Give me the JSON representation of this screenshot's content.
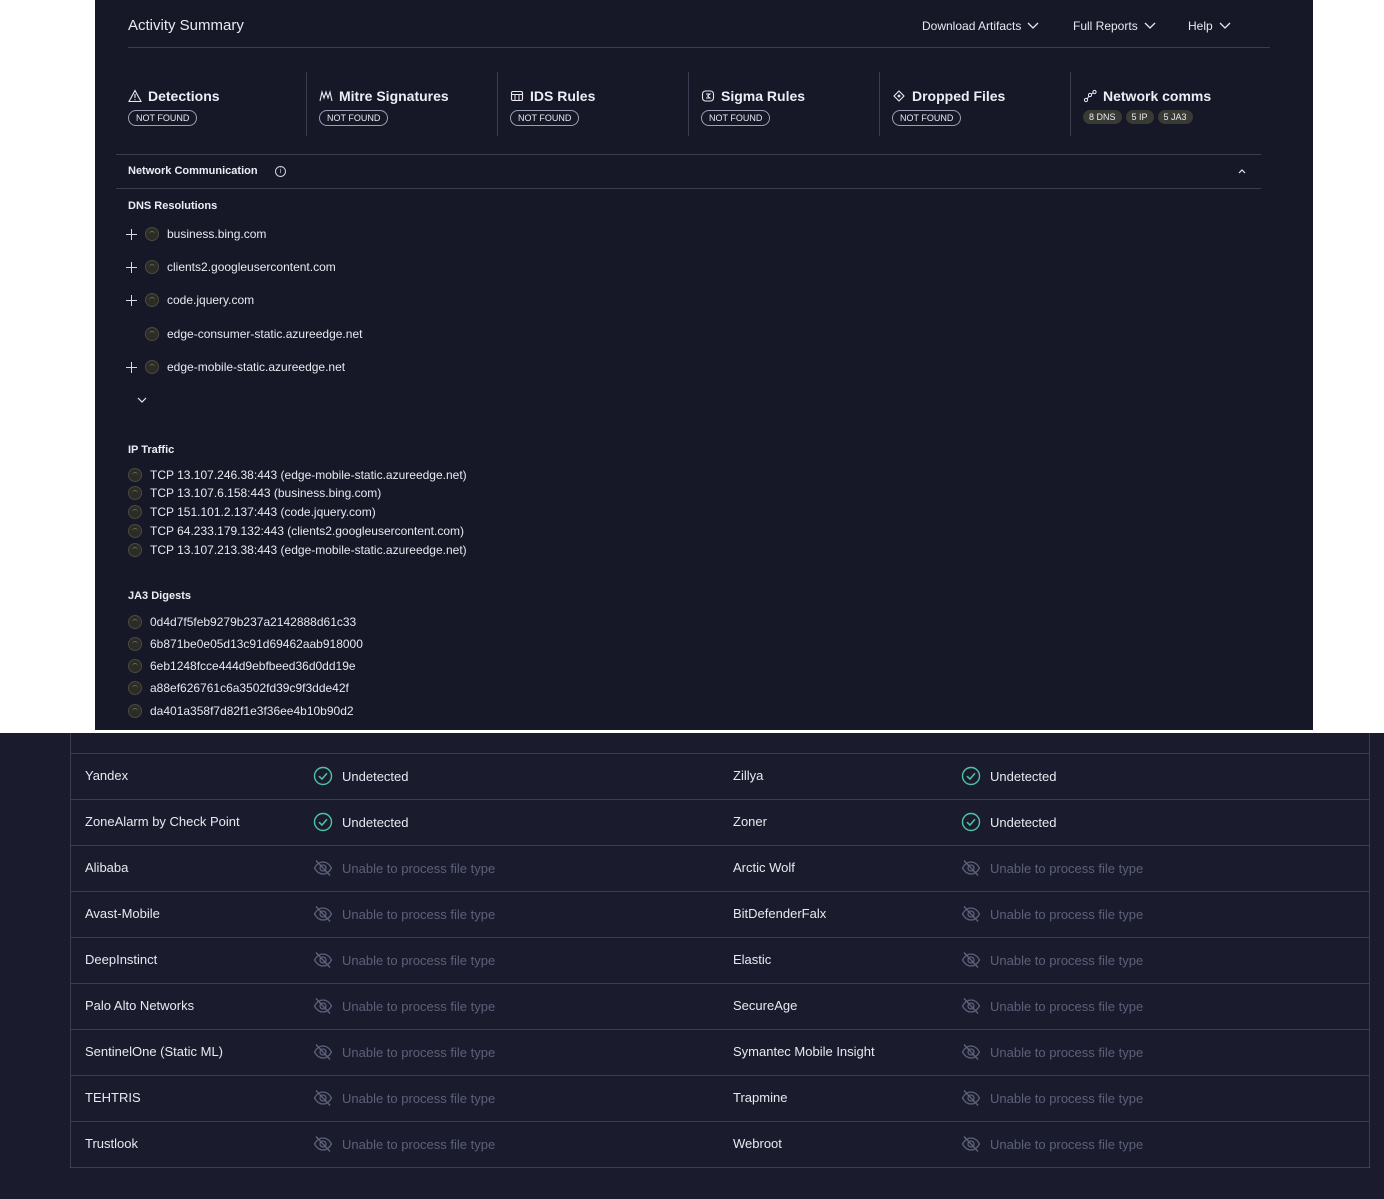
{
  "header": {
    "title": "Activity Summary",
    "menus": [
      "Download Artifacts",
      "Full Reports",
      "Help"
    ]
  },
  "cards": [
    {
      "icon": "warning-triangle-icon",
      "title": "Detections",
      "badge": "NOT FOUND"
    },
    {
      "icon": "mitre-icon",
      "title": "Mitre Signatures",
      "badge": "NOT FOUND"
    },
    {
      "icon": "ids-icon",
      "title": "IDS Rules",
      "badge": "NOT FOUND"
    },
    {
      "icon": "sigma-icon",
      "title": "Sigma Rules",
      "badge": "NOT FOUND"
    },
    {
      "icon": "dropped-files-icon",
      "title": "Dropped Files",
      "badge": "NOT FOUND"
    },
    {
      "icon": "network-icon",
      "title": "Network comms",
      "pills": [
        "8 DNS",
        "5 IP",
        "5 JA3"
      ]
    }
  ],
  "network": {
    "title": "Network Communication",
    "dns_title": "DNS Resolutions",
    "dns": [
      {
        "host": "business.bing.com",
        "expandable": true
      },
      {
        "host": "clients2.googleusercontent.com",
        "expandable": true
      },
      {
        "host": "code.jquery.com",
        "expandable": true
      },
      {
        "host": "edge-consumer-static.azureedge.net",
        "expandable": false
      },
      {
        "host": "edge-mobile-static.azureedge.net",
        "expandable": true
      }
    ],
    "ip_title": "IP Traffic",
    "ip": [
      "TCP 13.107.246.38:443 (edge-mobile-static.azureedge.net)",
      "TCP 13.107.6.158:443 (business.bing.com)",
      "TCP 151.101.2.137:443 (code.jquery.com)",
      "TCP 64.233.179.132:443 (clients2.googleusercontent.com)",
      "TCP 13.107.213.38:443 (edge-mobile-static.azureedge.net)"
    ],
    "ja3_title": "JA3 Digests",
    "ja3": [
      "0d4d7f5feb9279b237a2142888d61c33",
      "6b871be0e05d13c91d69462aab918000",
      "6eb1248fcce444d9ebfbeed36d0dd19e",
      "a88ef626761c6a3502fd39c9f3dde42f",
      "da401a358f7d82f1e3f36ee4b10b90d2"
    ]
  },
  "vendors": {
    "status_undetected": "Undetected",
    "status_unable": "Unable to process file type",
    "rows": [
      {
        "left": "Yandex",
        "left_status": "undetected",
        "right": "Zillya",
        "right_status": "undetected"
      },
      {
        "left": "ZoneAlarm by Check Point",
        "left_status": "undetected",
        "right": "Zoner",
        "right_status": "undetected"
      },
      {
        "left": "Alibaba",
        "left_status": "unable",
        "right": "Arctic Wolf",
        "right_status": "unable"
      },
      {
        "left": "Avast-Mobile",
        "left_status": "unable",
        "right": "BitDefenderFalx",
        "right_status": "unable"
      },
      {
        "left": "DeepInstinct",
        "left_status": "unable",
        "right": "Elastic",
        "right_status": "unable"
      },
      {
        "left": "Palo Alto Networks",
        "left_status": "unable",
        "right": "SecureAge",
        "right_status": "unable"
      },
      {
        "left": "SentinelOne (Static ML)",
        "left_status": "unable",
        "right": "Symantec Mobile Insight",
        "right_status": "unable"
      },
      {
        "left": "TEHTRIS",
        "left_status": "unable",
        "right": "Trapmine",
        "right_status": "unable"
      },
      {
        "left": "Trustlook",
        "left_status": "unable",
        "right": "Webroot",
        "right_status": "unable"
      }
    ]
  },
  "colors": {
    "panel": "#161828",
    "table_bg": "#1a1c2d",
    "ok_icon": "#4fc3a8",
    "muted": "#5c6079"
  }
}
